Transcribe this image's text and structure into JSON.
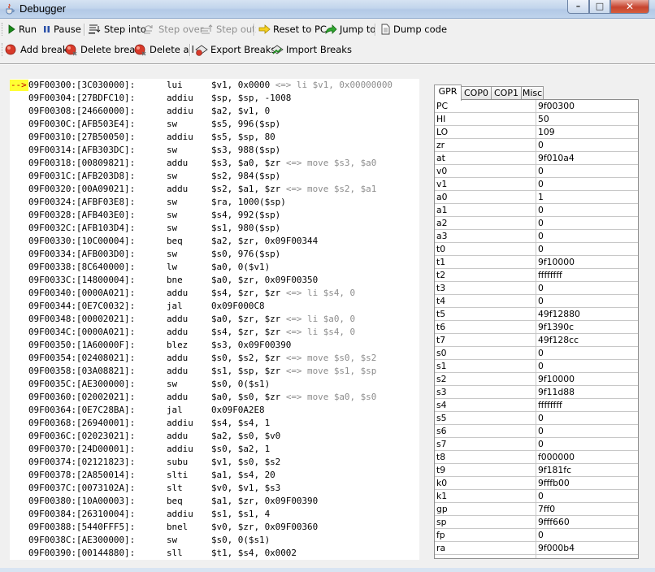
{
  "window": {
    "title": "Debugger"
  },
  "toolbar1": [
    {
      "label": "Run",
      "icon": "play-icon",
      "disabled": false
    },
    {
      "label": "Pause",
      "icon": "pause-icon",
      "disabled": false
    },
    {
      "label": "Step into",
      "icon": "step-into-icon",
      "disabled": false
    },
    {
      "label": "Step over",
      "icon": "step-over-icon",
      "disabled": true
    },
    {
      "label": "Step out",
      "icon": "step-out-icon",
      "disabled": true
    },
    {
      "label": "Reset to PC",
      "icon": "arrow-right-icon",
      "disabled": false
    },
    {
      "label": "Jump to",
      "icon": "jump-arrow-icon",
      "disabled": false
    },
    {
      "label": "Dump code",
      "icon": "document-icon",
      "disabled": false
    }
  ],
  "toolbar2": [
    {
      "label": "Add break",
      "icon": "breakpoint-icon"
    },
    {
      "label": "Delete break",
      "icon": "breakpoint-delete-icon"
    },
    {
      "label": "Delete all",
      "icon": "breakpoint-delete-all-icon"
    },
    {
      "label": "Export Breaks",
      "icon": "export-icon"
    },
    {
      "label": "Import Breaks",
      "icon": "import-icon"
    }
  ],
  "code": {
    "current_marker": "-->",
    "lines": [
      {
        "addr": "09F00300:[3C030000]:",
        "mn": "lui",
        "op": "$v1, 0x0000",
        "alias": "<=> li $v1, 0x00000000"
      },
      {
        "addr": "09F00304:[27BDFC10]:",
        "mn": "addiu",
        "op": "$sp, $sp, -1008",
        "alias": ""
      },
      {
        "addr": "09F00308:[24660000]:",
        "mn": "addiu",
        "op": "$a2, $v1, 0",
        "alias": ""
      },
      {
        "addr": "09F0030C:[AFB503E4]:",
        "mn": "sw",
        "op": "$s5, 996($sp)",
        "alias": ""
      },
      {
        "addr": "09F00310:[27B50050]:",
        "mn": "addiu",
        "op": "$s5, $sp, 80",
        "alias": ""
      },
      {
        "addr": "09F00314:[AFB303DC]:",
        "mn": "sw",
        "op": "$s3, 988($sp)",
        "alias": ""
      },
      {
        "addr": "09F00318:[00809821]:",
        "mn": "addu",
        "op": "$s3, $a0, $zr",
        "alias": "<=> move $s3, $a0"
      },
      {
        "addr": "09F0031C:[AFB203D8]:",
        "mn": "sw",
        "op": "$s2, 984($sp)",
        "alias": ""
      },
      {
        "addr": "09F00320:[00A09021]:",
        "mn": "addu",
        "op": "$s2, $a1, $zr",
        "alias": "<=> move $s2, $a1"
      },
      {
        "addr": "09F00324:[AFBF03E8]:",
        "mn": "sw",
        "op": "$ra, 1000($sp)",
        "alias": ""
      },
      {
        "addr": "09F00328:[AFB403E0]:",
        "mn": "sw",
        "op": "$s4, 992($sp)",
        "alias": ""
      },
      {
        "addr": "09F0032C:[AFB103D4]:",
        "mn": "sw",
        "op": "$s1, 980($sp)",
        "alias": ""
      },
      {
        "addr": "09F00330:[10C00004]:",
        "mn": "beq",
        "op": "$a2, $zr, 0x09F00344",
        "alias": ""
      },
      {
        "addr": "09F00334:[AFB003D0]:",
        "mn": "sw",
        "op": "$s0, 976($sp)",
        "alias": ""
      },
      {
        "addr": "09F00338:[8C640000]:",
        "mn": "lw",
        "op": "$a0, 0($v1)",
        "alias": ""
      },
      {
        "addr": "09F0033C:[14800004]:",
        "mn": "bne",
        "op": "$a0, $zr, 0x09F00350",
        "alias": ""
      },
      {
        "addr": "09F00340:[0000A021]:",
        "mn": "addu",
        "op": "$s4, $zr, $zr",
        "alias": "<=> li $s4, 0"
      },
      {
        "addr": "09F00344:[0E7C0032]:",
        "mn": "jal",
        "op": "0x09F000C8",
        "alias": ""
      },
      {
        "addr": "09F00348:[00002021]:",
        "mn": "addu",
        "op": "$a0, $zr, $zr",
        "alias": "<=> li $a0, 0"
      },
      {
        "addr": "09F0034C:[0000A021]:",
        "mn": "addu",
        "op": "$s4, $zr, $zr",
        "alias": "<=> li $s4, 0"
      },
      {
        "addr": "09F00350:[1A60000F]:",
        "mn": "blez",
        "op": "$s3, 0x09F00390",
        "alias": ""
      },
      {
        "addr": "09F00354:[02408021]:",
        "mn": "addu",
        "op": "$s0, $s2, $zr",
        "alias": "<=> move $s0, $s2"
      },
      {
        "addr": "09F00358:[03A08821]:",
        "mn": "addu",
        "op": "$s1, $sp, $zr",
        "alias": "<=> move $s1, $sp"
      },
      {
        "addr": "09F0035C:[AE300000]:",
        "mn": "sw",
        "op": "$s0, 0($s1)",
        "alias": ""
      },
      {
        "addr": "09F00360:[02002021]:",
        "mn": "addu",
        "op": "$a0, $s0, $zr",
        "alias": "<=> move $a0, $s0"
      },
      {
        "addr": "09F00364:[0E7C28BA]:",
        "mn": "jal",
        "op": "0x09F0A2E8",
        "alias": ""
      },
      {
        "addr": "09F00368:[26940001]:",
        "mn": "addiu",
        "op": "$s4, $s4, 1",
        "alias": ""
      },
      {
        "addr": "09F0036C:[02023021]:",
        "mn": "addu",
        "op": "$a2, $s0, $v0",
        "alias": ""
      },
      {
        "addr": "09F00370:[24D00001]:",
        "mn": "addiu",
        "op": "$s0, $a2, 1",
        "alias": ""
      },
      {
        "addr": "09F00374:[02121823]:",
        "mn": "subu",
        "op": "$v1, $s0, $s2",
        "alias": ""
      },
      {
        "addr": "09F00378:[2A850014]:",
        "mn": "slti",
        "op": "$a1, $s4, 20",
        "alias": ""
      },
      {
        "addr": "09F0037C:[0073102A]:",
        "mn": "slt",
        "op": "$v0, $v1, $s3",
        "alias": ""
      },
      {
        "addr": "09F00380:[10A00003]:",
        "mn": "beq",
        "op": "$a1, $zr, 0x09F00390",
        "alias": ""
      },
      {
        "addr": "09F00384:[26310004]:",
        "mn": "addiu",
        "op": "$s1, $s1, 4",
        "alias": ""
      },
      {
        "addr": "09F00388:[5440FFF5]:",
        "mn": "bnel",
        "op": "$v0, $zr, 0x09F00360",
        "alias": ""
      },
      {
        "addr": "09F0038C:[AE300000]:",
        "mn": "sw",
        "op": "$s0, 0($s1)",
        "alias": ""
      },
      {
        "addr": "09F00390:[00144880]:",
        "mn": "sll",
        "op": "$t1, $s4, 0x0002",
        "alias": ""
      }
    ]
  },
  "tabs": [
    "GPR",
    "COP0",
    "COP1",
    "Misc"
  ],
  "active_tab": "GPR",
  "registers": [
    {
      "name": "PC",
      "value": "9f00300"
    },
    {
      "name": "HI",
      "value": "50"
    },
    {
      "name": "LO",
      "value": "109"
    },
    {
      "name": "zr",
      "value": "0"
    },
    {
      "name": "at",
      "value": "9f010a4"
    },
    {
      "name": "v0",
      "value": "0"
    },
    {
      "name": "v1",
      "value": "0"
    },
    {
      "name": "a0",
      "value": "1"
    },
    {
      "name": "a1",
      "value": "0"
    },
    {
      "name": "a2",
      "value": "0"
    },
    {
      "name": "a3",
      "value": "0"
    },
    {
      "name": "t0",
      "value": "0"
    },
    {
      "name": "t1",
      "value": "9f10000"
    },
    {
      "name": "t2",
      "value": "ffffffff"
    },
    {
      "name": "t3",
      "value": "0"
    },
    {
      "name": "t4",
      "value": "0"
    },
    {
      "name": "t5",
      "value": "49f12880"
    },
    {
      "name": "t6",
      "value": "9f1390c"
    },
    {
      "name": "t7",
      "value": "49f128cc"
    },
    {
      "name": "s0",
      "value": "0"
    },
    {
      "name": "s1",
      "value": "0"
    },
    {
      "name": "s2",
      "value": "9f10000"
    },
    {
      "name": "s3",
      "value": "9f11d88"
    },
    {
      "name": "s4",
      "value": "ffffffff"
    },
    {
      "name": "s5",
      "value": "0"
    },
    {
      "name": "s6",
      "value": "0"
    },
    {
      "name": "s7",
      "value": "0"
    },
    {
      "name": "t8",
      "value": "f000000"
    },
    {
      "name": "t9",
      "value": "9f181fc"
    },
    {
      "name": "k0",
      "value": "9fffb00"
    },
    {
      "name": "k1",
      "value": "0"
    },
    {
      "name": "gp",
      "value": "7ff0"
    },
    {
      "name": "sp",
      "value": "9fff660"
    },
    {
      "name": "fp",
      "value": "0"
    },
    {
      "name": "ra",
      "value": "9f000b4"
    }
  ]
}
